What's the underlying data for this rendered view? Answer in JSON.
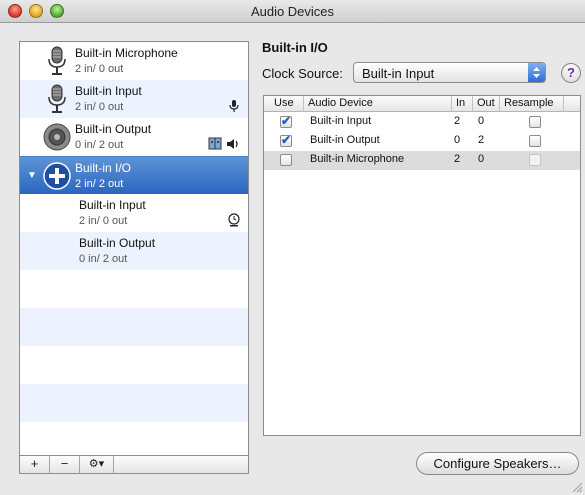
{
  "window": {
    "title": "Audio Devices"
  },
  "devices": [
    {
      "name": "Built-in Microphone",
      "io": "2 in/ 0 out",
      "icon": "microphone-icon"
    },
    {
      "name": "Built-in Input",
      "io": "2 in/ 0 out",
      "icon": "microphone-icon",
      "badge": "microphone-icon"
    },
    {
      "name": "Built-in Output",
      "io": "0 in/ 2 out",
      "icon": "speaker-icon",
      "badge": "finder-speaker-icon"
    },
    {
      "name": "Built-in I/O",
      "io": "2 in/ 2 out",
      "icon": "aggregate-device-icon",
      "selected": true
    },
    {
      "name": "Built-in Input",
      "io": "2 in/ 0 out",
      "sub": true,
      "badge": "clock-icon"
    },
    {
      "name": "Built-in Output",
      "io": "0 in/ 2 out",
      "sub": true
    }
  ],
  "toolbar": {
    "add": "+",
    "remove": "−",
    "gear": "⚙▾"
  },
  "detail": {
    "title": "Built-in I/O",
    "clock_label": "Clock Source:",
    "clock_value": "Built-in Input",
    "help": "?"
  },
  "table": {
    "headers": {
      "use": "Use",
      "device": "Audio Device",
      "in": "In",
      "out": "Out",
      "resample": "Resample"
    },
    "rows": [
      {
        "use": true,
        "device": "Built-in Input",
        "in": "2",
        "out": "0",
        "resample": false,
        "resample_enabled": true
      },
      {
        "use": true,
        "device": "Built-in Output",
        "in": "0",
        "out": "2",
        "resample": false,
        "resample_enabled": true
      },
      {
        "use": false,
        "device": "Built-in Microphone",
        "in": "2",
        "out": "0",
        "resample": false,
        "resample_enabled": false
      }
    ]
  },
  "buttons": {
    "configure": "Configure Speakers…"
  },
  "colors": {
    "selection": "#2a66c0",
    "stripe": "#edf3fe",
    "check": "#1f5fc2"
  }
}
